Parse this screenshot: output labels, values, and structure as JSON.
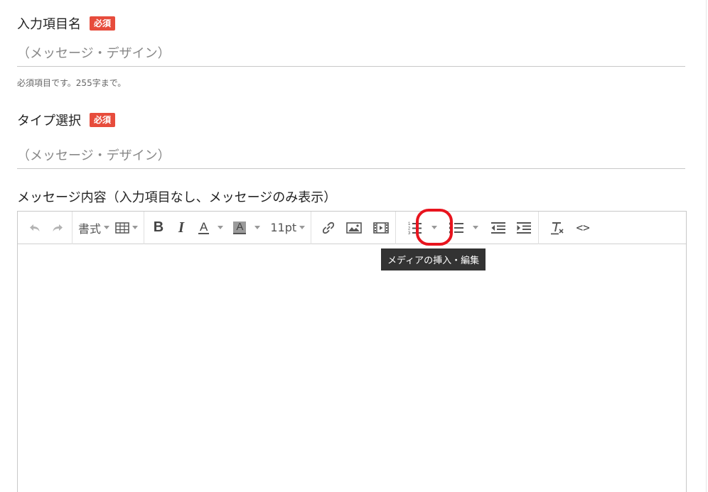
{
  "form": {
    "field1": {
      "label": "入力項目名",
      "required_badge": "必須",
      "value": "（メッセージ・デザイン）",
      "help": "必須項目です。255字まで。"
    },
    "field2": {
      "label": "タイプ選択",
      "required_badge": "必須",
      "value": "（メッセージ・デザイン）"
    },
    "field3": {
      "label": "メッセージ内容（入力項目なし、メッセージのみ表示）"
    }
  },
  "editor": {
    "toolbar": {
      "format_label": "書式",
      "font_size_label": "11pt",
      "bold_label": "B",
      "italic_label": "I",
      "text_color_label": "A",
      "bg_color_label": "A",
      "code_label": "<>"
    },
    "icons": {
      "undo": "undo-icon",
      "redo": "redo-icon",
      "table": "table-icon",
      "link": "link-icon",
      "image": "image-icon",
      "media": "media-film-icon",
      "numbered_list": "numbered-list-icon",
      "bullet_list": "bullet-list-icon",
      "outdent": "outdent-icon",
      "indent": "indent-icon",
      "clear_format": "clear-formatting-icon"
    },
    "tooltip": "メディアの挿入・編集"
  },
  "colors": {
    "required_badge": "#e74c3c",
    "highlight_ring": "#e8141e",
    "tooltip_bg": "#333333",
    "text_color_underline": "#555555",
    "bg_color_fill": "#9a9a9a"
  }
}
